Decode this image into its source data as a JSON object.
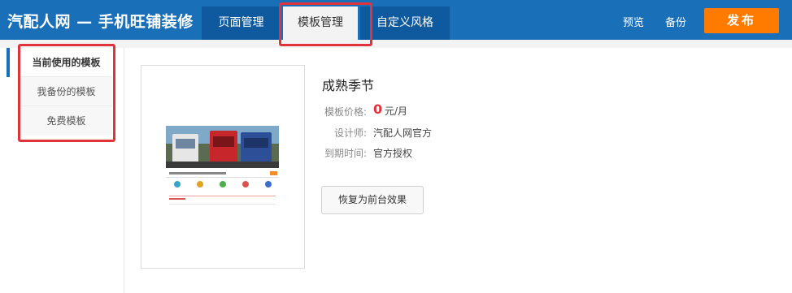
{
  "header": {
    "title": "汽配人网 — 手机旺铺装修",
    "tabs": [
      {
        "label": "页面管理"
      },
      {
        "label": "模板管理"
      },
      {
        "label": "自定义风格"
      }
    ],
    "preview_label": "预览",
    "backup_label": "备份",
    "publish_label": "发布"
  },
  "sidebar": {
    "items": [
      {
        "label": "当前使用的模板"
      },
      {
        "label": "我备份的模板"
      },
      {
        "label": "免费模板"
      }
    ]
  },
  "template": {
    "name": "成熟季节",
    "price_label": "模板价格:",
    "price_value": "0",
    "price_unit": "元/月",
    "designer_label": "设计师:",
    "designer_value": "汽配人网官方",
    "expiry_label": "到期时间:",
    "expiry_value": "官方授权",
    "restore_label": "恢复为前台效果"
  },
  "colors": {
    "header": "#1a6fb9",
    "tab_dark": "#0f5a9f",
    "publish": "#ff7b00",
    "highlight": "#e0333b",
    "price": "#e0333b"
  }
}
